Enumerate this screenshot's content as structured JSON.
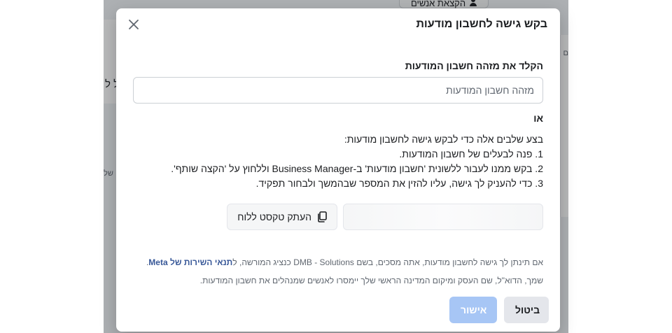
{
  "background": {
    "top_button_label": "הקצאת אנשים",
    "left_fragment": "ל ל",
    "left_fragment_2": "של",
    "right_fragment": "ם"
  },
  "modal": {
    "title": "בקש גישה לחשבון מודעות",
    "field_label": "הקלד את מזהה חשבון המודעות",
    "input_placeholder": "מזהה חשבון המודעות",
    "input_value": "",
    "or_text": "או",
    "steps_intro": "בצע שלבים אלה כדי לבקש גישה לחשבון מודעות:",
    "steps": [
      "1. פנה לבעלים של חשבון המודעות.",
      "2. בקש ממנו לעבור ללשונית 'חשבון מודעות' ב-Business Manager וללחוץ על 'הקצה שותף'.",
      "3. כדי להעניק לך גישה, עליו להזין את המספר שבהמשך ולבחור תפקיד."
    ],
    "copy_button_label": "העתק טקסט ללוח",
    "terms_text": "אם תינתן לך גישה לחשבון מודעות, אתה מסכים, בשם DMB - Solutions כנציג המורשה, ל",
    "terms_link": "תנאי השירות של Meta",
    "terms_end": ".",
    "privacy_text": "שמך, הדוא\"ל, שם העסק ומיקום המדינה הראשי שלך יימסרו לאנשים שמנהלים את חשבון המודעות.",
    "cancel_label": "ביטול",
    "confirm_label": "אישור"
  },
  "icons": {
    "close": "close-icon",
    "copy": "copy-icon",
    "person": "person-icon"
  },
  "colors": {
    "confirm_disabled": "#a7c6f5",
    "link": "#385898",
    "cancel_bg": "#e4e6eb"
  }
}
